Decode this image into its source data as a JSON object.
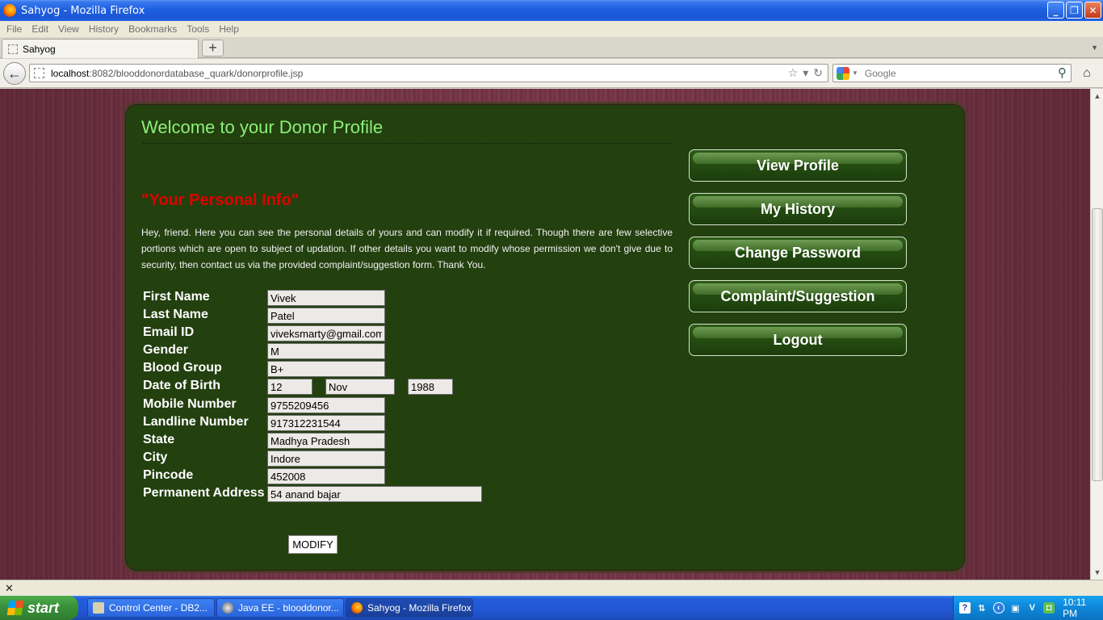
{
  "window": {
    "title": "Sahyog - Mozilla Firefox"
  },
  "menu": [
    "File",
    "Edit",
    "View",
    "History",
    "Bookmarks",
    "Tools",
    "Help"
  ],
  "tabs": [
    {
      "label": "Sahyog"
    }
  ],
  "nav": {
    "url_host": "localhost",
    "url_rest": ":8082/blooddonordatabase_quark/donorprofile.jsp",
    "search_placeholder": "Google"
  },
  "page": {
    "welcome": "Welcome to your Donor Profile",
    "personal_title": "\"Your Personal Info\"",
    "intro": "Hey, friend. Here you can see the personal details of yours and can modify it if required. Though there are few selective portions which are open to subject of updation. If other details you want to modify whose permission we don't give due to security, then contact us via the provided complaint/suggestion form. Thank You.",
    "fields": {
      "first_name": {
        "label": "First Name",
        "value": "Vivek"
      },
      "last_name": {
        "label": "Last Name",
        "value": "Patel"
      },
      "email": {
        "label": "Email ID",
        "value": "viveksmarty@gmail.com"
      },
      "gender": {
        "label": "Gender",
        "value": "M"
      },
      "blood_group": {
        "label": "Blood Group",
        "value": "B+"
      },
      "dob": {
        "label": "Date of Birth",
        "day": "12",
        "month": "Nov",
        "year": "1988"
      },
      "mobile": {
        "label": "Mobile Number",
        "value": "9755209456"
      },
      "landline": {
        "label": "Landline Number",
        "value": "917312231544"
      },
      "state": {
        "label": "State",
        "value": "Madhya Pradesh"
      },
      "city": {
        "label": "City",
        "value": "Indore"
      },
      "pincode": {
        "label": "Pincode",
        "value": "452008"
      },
      "address": {
        "label": "Permanent Address",
        "value": "54 anand bajar"
      }
    },
    "modify_label": "MODIFY",
    "sidebar": [
      "View Profile",
      "My History",
      "Change Password",
      "Complaint/Suggestion",
      "Logout"
    ]
  },
  "taskbar": {
    "start": "start",
    "tasks": [
      "Control Center - DB2...",
      "Java EE - blooddonor...",
      "Sahyog - Mozilla Firefox"
    ],
    "clock": "10:11 PM"
  }
}
